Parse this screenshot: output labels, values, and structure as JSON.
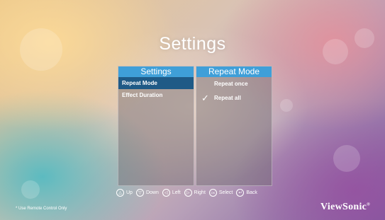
{
  "screen": {
    "title": "Settings"
  },
  "left_panel": {
    "header": "Settings",
    "items": [
      {
        "label": "Repeat Mode",
        "selected": true
      },
      {
        "label": "Effect Duration",
        "selected": false
      }
    ]
  },
  "right_panel": {
    "header": "Repeat Mode",
    "options": [
      {
        "label": "Repeat once",
        "checked": false
      },
      {
        "label": "Repeat all",
        "checked": true
      }
    ]
  },
  "hints": [
    {
      "icon": "up-arrow-icon",
      "glyph": "△",
      "label": "Up"
    },
    {
      "icon": "down-arrow-icon",
      "glyph": "▽",
      "label": "Down"
    },
    {
      "icon": "left-arrow-icon",
      "glyph": "◁",
      "label": "Left"
    },
    {
      "icon": "right-arrow-icon",
      "glyph": "▷",
      "label": "Right"
    },
    {
      "icon": "ok-icon",
      "glyph": "OK",
      "label": "Select"
    },
    {
      "icon": "back-icon",
      "glyph": "↩",
      "label": "Back"
    }
  ],
  "footer": {
    "note": "* Use Remote Control Only",
    "brand": "ViewSonic",
    "brand_mark": "®"
  },
  "colors": {
    "accent": "#3f9fd8",
    "selected": "#1f5a86"
  }
}
